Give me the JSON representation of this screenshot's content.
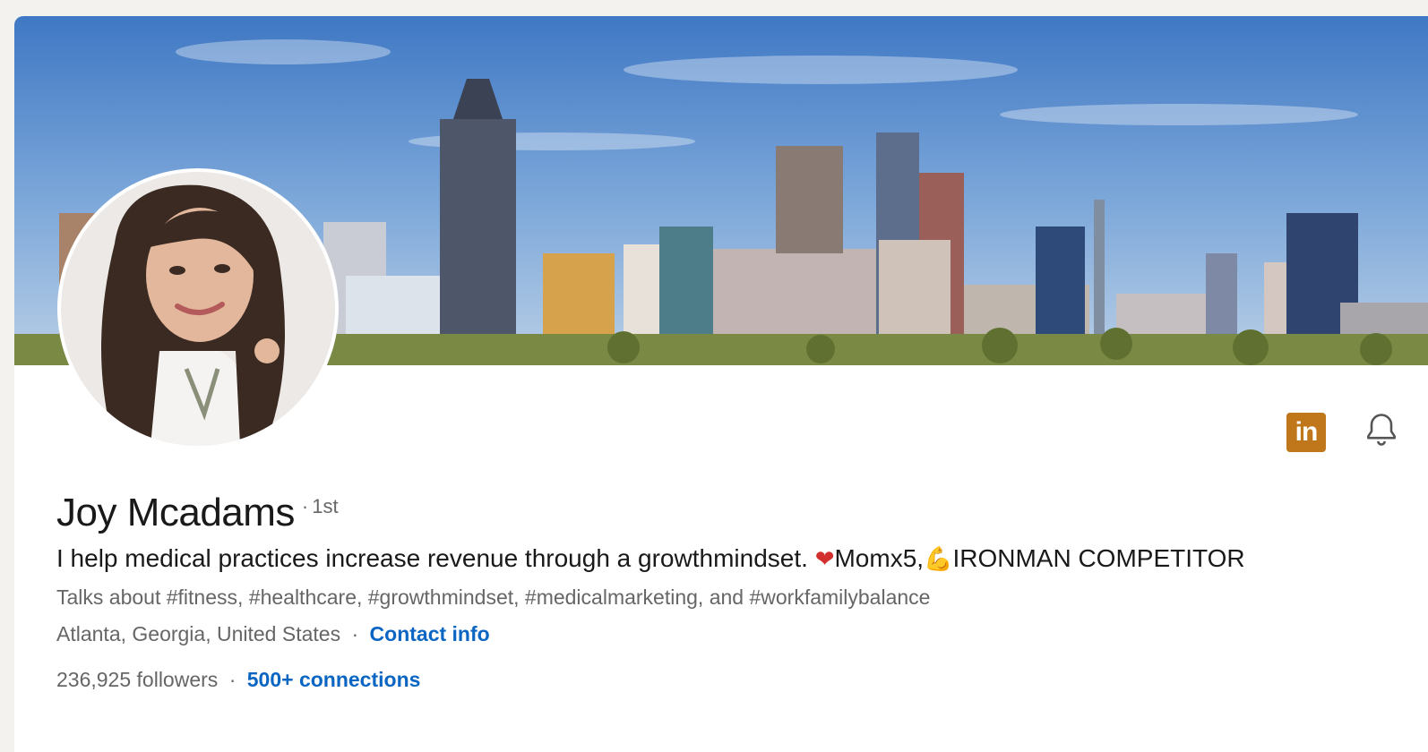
{
  "profile": {
    "name": "Joy Mcadams",
    "degree": "1st",
    "degree_separator": "·",
    "headline_part1": "I help medical practices increase revenue through a growthmindset.",
    "headline_heart": "❤",
    "headline_part2": "Momx5,",
    "headline_arm": "💪",
    "headline_part3": "IRONMAN COMPETITOR",
    "talks_about": "Talks about #fitness, #healthcare, #growthmindset, #medicalmarketing, and #workfamilybalance",
    "location": "Atlanta, Georgia, United States",
    "location_separator": "·",
    "contact_info_label": "Contact info",
    "followers": "236,925 followers",
    "stats_separator": "·",
    "connections_label": "500+ connections"
  },
  "actions": {
    "linkedin_badge_text": "in",
    "bell_icon": "bell-icon"
  },
  "colors": {
    "link": "#0a66c2",
    "badge": "#c0771c",
    "heart": "#d32f2f"
  }
}
